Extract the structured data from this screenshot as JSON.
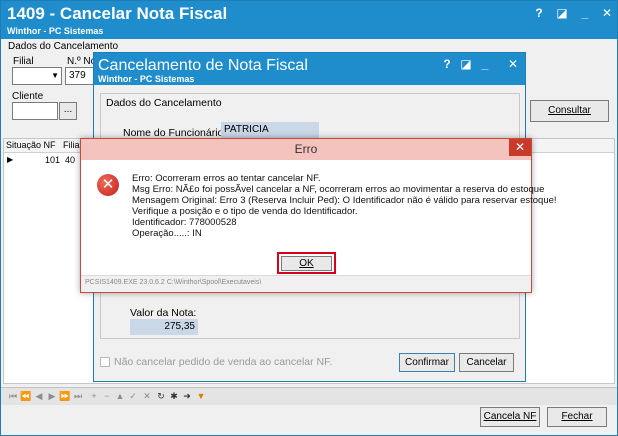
{
  "main": {
    "title": "1409 - Cancelar Nota Fiscal",
    "subtitle": "Winthor - PC Sistemas",
    "section_label": "Dados do Cancelamento",
    "filial_label": "Filial",
    "nonota_label": "N.º No",
    "nonota_value": "379",
    "cliente_label": "Cliente",
    "consultar_label": "Consultar",
    "grid_headers": [
      "Situação NF",
      "Filial"
    ],
    "grid_row": [
      "101",
      "40"
    ],
    "cancela_nf_label": "Cancela NF",
    "fechar_label": "Fechar"
  },
  "cancel_dialog": {
    "title": "Cancelamento de Nota Fiscal",
    "subtitle": "Winthor - PC Sistemas",
    "group_label": "Dados do Cancelamento",
    "funcionario_label": "Nome do Funcionário:",
    "funcionario_value": "PATRICIA",
    "valor_label": "Valor da Nota:",
    "valor_value": "275,35",
    "checkbox_label": "Não cancelar pedido de venda ao cancelar NF.",
    "confirmar_label": "Confirmar",
    "cancelar_label": "Cancelar"
  },
  "error_dialog": {
    "title": "Erro",
    "close_glyph": "✕",
    "icon_glyph": "✕",
    "lines": [
      "Erro: Ocorreram erros ao tentar cancelar NF.",
      "Msg Erro: NÃ£o foi possÃ­vel cancelar a NF, ocorreram erros ao movimentar a reserva do estoque",
      "Mensagem Original: Erro 3 (Reserva Incluir Ped): O Identificador não é válido para reservar estoque!",
      "Verifique a posição e o tipo de venda do Identificador.",
      "Identificador: 778000528",
      "Operação.....: IN"
    ],
    "ok_label": "OK",
    "footer_path": "PCSIS1409.EXE 23.0.6.2 C:\\Winthor\\Spool\\Executaveis\\"
  },
  "colors": {
    "titlebar": "#1f8ccc",
    "error_titlebar": "#f5c3bd",
    "error_close": "#c83b2a",
    "ok_highlight": "#d6001c"
  }
}
